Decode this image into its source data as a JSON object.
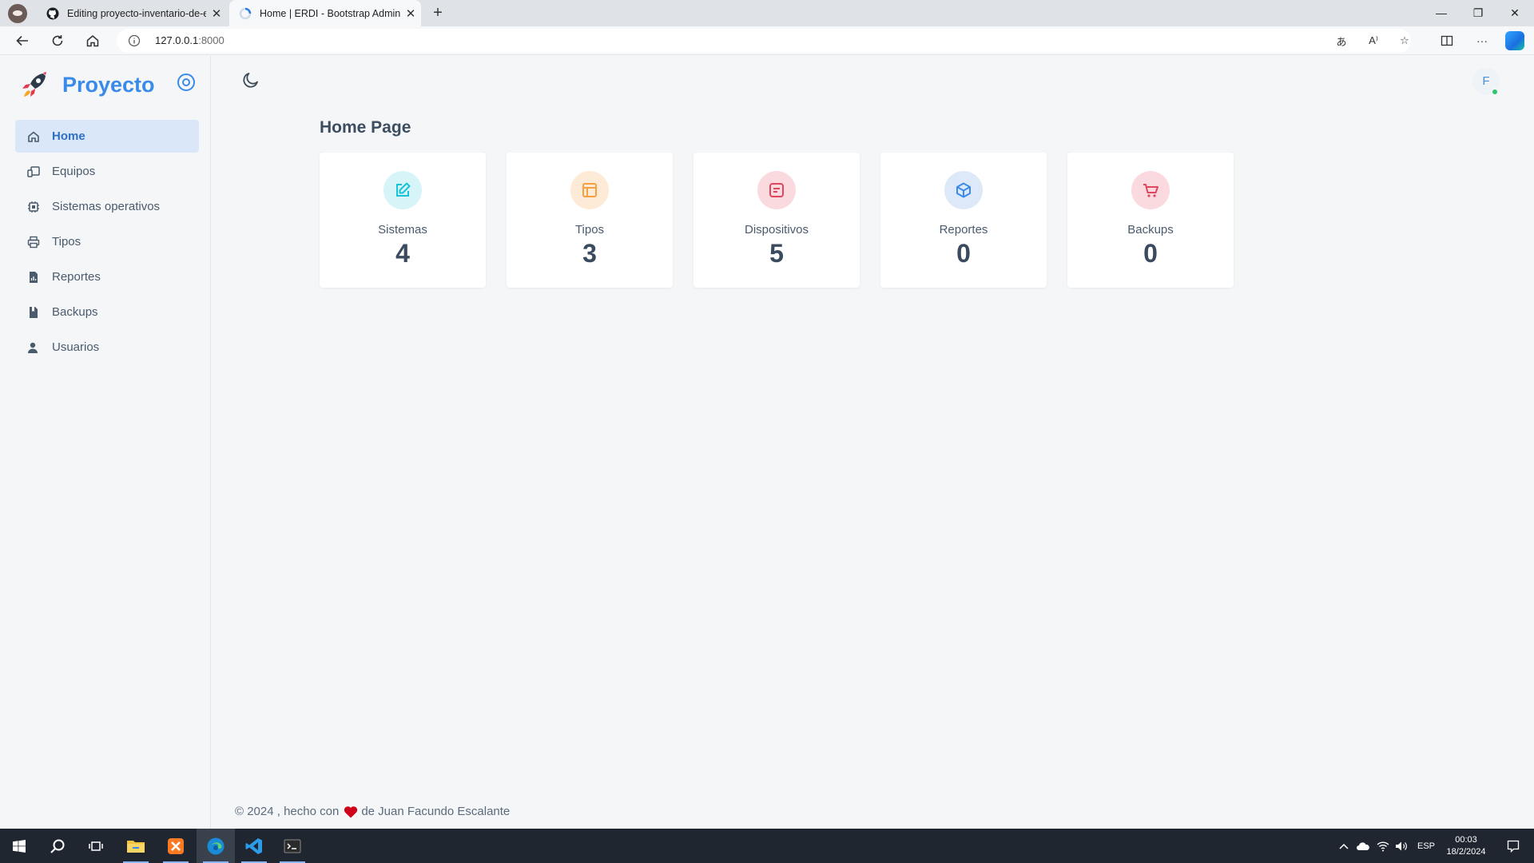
{
  "browser": {
    "tabs": [
      {
        "title": "Editing proyecto-inventario-de-e",
        "active": false
      },
      {
        "title": "Home | ERDI - Bootstrap Admin",
        "active": true
      }
    ],
    "url_host": "127.0.0.1",
    "url_port": ":8000"
  },
  "sidebar": {
    "brand": "Proyecto",
    "items": [
      {
        "label": "Home",
        "icon": "home-icon",
        "active": true
      },
      {
        "label": "Equipos",
        "icon": "devices-icon",
        "active": false
      },
      {
        "label": "Sistemas operativos",
        "icon": "cpu-icon",
        "active": false
      },
      {
        "label": "Tipos",
        "icon": "printer-icon",
        "active": false
      },
      {
        "label": "Reportes",
        "icon": "report-file-icon",
        "active": false
      },
      {
        "label": "Backups",
        "icon": "backup-file-icon",
        "active": false
      },
      {
        "label": "Usuarios",
        "icon": "user-icon",
        "active": false
      }
    ]
  },
  "header": {
    "avatar_initial": "F"
  },
  "main": {
    "title": "Home Page",
    "cards": [
      {
        "label": "Sistemas",
        "value": "4",
        "icon": "edit-icon",
        "color": "#17c3d6",
        "bg": "#d7f4f8"
      },
      {
        "label": "Tipos",
        "value": "3",
        "icon": "layout-icon",
        "color": "#f5a142",
        "bg": "#fdebd7"
      },
      {
        "label": "Dispositivos",
        "value": "5",
        "icon": "message-square-icon",
        "color": "#e0475f",
        "bg": "#fadadf"
      },
      {
        "label": "Reportes",
        "value": "0",
        "icon": "box-icon",
        "color": "#3a8be8",
        "bg": "#dde9f8"
      },
      {
        "label": "Backups",
        "value": "0",
        "icon": "cart-icon",
        "color": "#e0475f",
        "bg": "#fadadf"
      }
    ]
  },
  "footer": {
    "prefix": "© 2024 , hecho con",
    "suffix": "de Juan Facundo Escalante"
  },
  "taskbar": {
    "language": "ESP",
    "time": "00:03",
    "date": "18/2/2024"
  }
}
